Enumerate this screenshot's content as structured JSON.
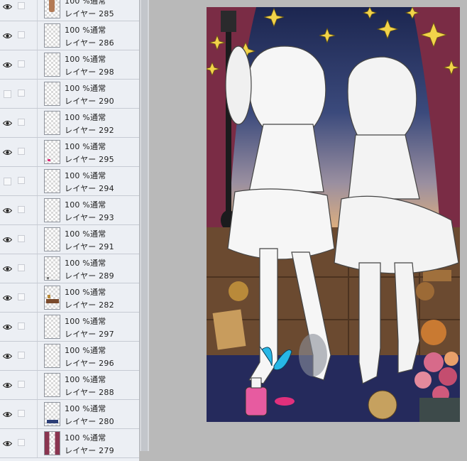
{
  "layers_panel": {
    "blend_mode": "100 %通常",
    "layers": [
      {
        "name": "レイヤー 285",
        "visible": true,
        "thumb": "small-figure"
      },
      {
        "name": "レイヤー 286",
        "visible": true,
        "thumb": "empty"
      },
      {
        "name": "レイヤー 298",
        "visible": true,
        "thumb": "empty"
      },
      {
        "name": "レイヤー 290",
        "visible": false,
        "thumb": "empty"
      },
      {
        "name": "レイヤー 292",
        "visible": true,
        "thumb": "empty"
      },
      {
        "name": "レイヤー 295",
        "visible": true,
        "thumb": "pink-dot"
      },
      {
        "name": "レイヤー 294",
        "visible": false,
        "thumb": "empty"
      },
      {
        "name": "レイヤー 293",
        "visible": true,
        "thumb": "empty"
      },
      {
        "name": "レイヤー 291",
        "visible": true,
        "thumb": "empty"
      },
      {
        "name": "レイヤー 289",
        "visible": true,
        "thumb": "tiny-mark"
      },
      {
        "name": "レイヤー 282",
        "visible": true,
        "thumb": "brown-scene"
      },
      {
        "name": "レイヤー 297",
        "visible": true,
        "thumb": "empty"
      },
      {
        "name": "レイヤー 296",
        "visible": true,
        "thumb": "empty"
      },
      {
        "name": "レイヤー 288",
        "visible": true,
        "thumb": "empty"
      },
      {
        "name": "レイヤー 280",
        "visible": true,
        "thumb": "blue-mark"
      },
      {
        "name": "レイヤー 279",
        "visible": true,
        "thumb": "curtain"
      }
    ]
  },
  "canvas": {
    "artwork_subject": "two-girls-sitting-on-trunk-illustration",
    "colors": {
      "curtain": "#8a3550",
      "sky_top": "#1f2a55",
      "sky_bottom": "#e7b27a",
      "wall": "#6b4a30",
      "floor": "#252a5c",
      "stars": "#f2d34a"
    }
  }
}
